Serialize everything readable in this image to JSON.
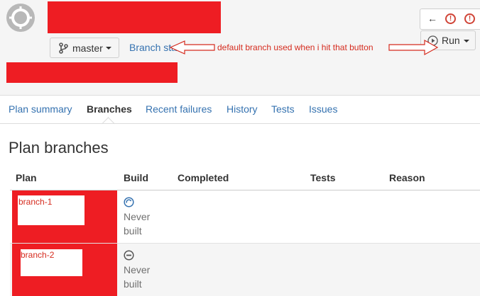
{
  "header": {
    "branch_selector_label": "master",
    "branch_status_link": "Branch sta",
    "run_button_label": "Run"
  },
  "annotation": {
    "text": "default branch used when i hit that button"
  },
  "nav": {
    "tabs": [
      {
        "label": "Plan summary"
      },
      {
        "label": "Branches"
      },
      {
        "label": "Recent failures"
      },
      {
        "label": "History"
      },
      {
        "label": "Tests"
      },
      {
        "label": "Issues"
      }
    ],
    "active_tab": "Branches"
  },
  "main": {
    "title": "Plan branches",
    "table": {
      "columns": [
        "Plan",
        "Build",
        "Completed",
        "Tests",
        "Reason"
      ],
      "rows": [
        {
          "plan": "branch-1",
          "build_line1": "Never",
          "build_line2": "built",
          "build_icon": "in-progress-icon"
        },
        {
          "plan": "branch-2",
          "build_line1": "Never",
          "build_line2": "built",
          "build_icon": "not-built-icon"
        }
      ]
    }
  },
  "colors": {
    "accent": "#3572b0",
    "redaction": "#ee1d23",
    "annotation": "#d52b1e",
    "alert": "#d04437"
  }
}
